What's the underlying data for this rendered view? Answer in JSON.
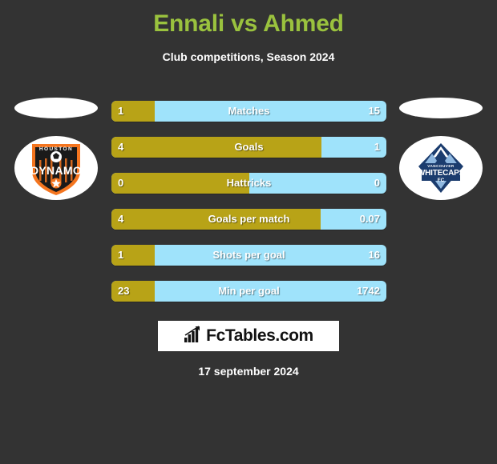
{
  "header": {
    "title": "Ennali vs Ahmed",
    "subtitle": "Club competitions, Season 2024",
    "title_color": "#9ac23e"
  },
  "teams": {
    "home": {
      "name": "Houston Dynamo",
      "crest_icon": "houston-dynamo-crest",
      "color": "#b8a317"
    },
    "away": {
      "name": "Vancouver Whitecaps FC",
      "crest_icon": "vancouver-whitecaps-crest",
      "color": "#9fe3fb"
    }
  },
  "chart_data": {
    "type": "bar",
    "title": "Ennali vs Ahmed",
    "subtitle": "Club competitions, Season 2024",
    "xlabel": "",
    "ylabel": "",
    "grid": false,
    "legend": "none",
    "orientation": "horizontal-diverging",
    "categories": [
      "Matches",
      "Goals",
      "Hattricks",
      "Goals per match",
      "Shots per goal",
      "Min per goal"
    ],
    "series": [
      {
        "name": "Ennali",
        "values": [
          1,
          4,
          0,
          4,
          1,
          23
        ]
      },
      {
        "name": "Ahmed",
        "values": [
          15,
          1,
          0,
          0.07,
          16,
          1742
        ]
      }
    ],
    "home_share_pct": [
      15.7,
      76.4,
      50.0,
      76.0,
      15.7,
      15.7
    ]
  },
  "rows": [
    {
      "label": "Matches",
      "home": "1",
      "away": "15",
      "home_pct": 15.7
    },
    {
      "label": "Goals",
      "home": "4",
      "away": "1",
      "home_pct": 76.4
    },
    {
      "label": "Hattricks",
      "home": "0",
      "away": "0",
      "home_pct": 50.0
    },
    {
      "label": "Goals per match",
      "home": "4",
      "away": "0.07",
      "home_pct": 76.0
    },
    {
      "label": "Shots per goal",
      "home": "1",
      "away": "16",
      "home_pct": 15.7
    },
    {
      "label": "Min per goal",
      "home": "23",
      "away": "1742",
      "home_pct": 15.7
    }
  ],
  "footer": {
    "brand": "FcTables.com",
    "brand_icon": "bar-chart-icon",
    "date": "17 september 2024"
  }
}
